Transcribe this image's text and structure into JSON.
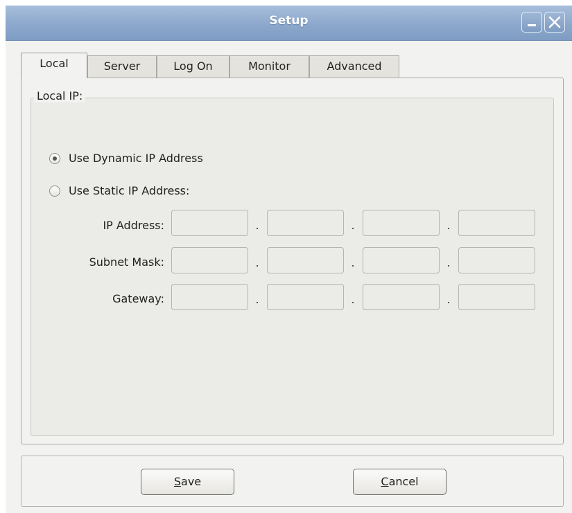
{
  "window": {
    "title": "Setup"
  },
  "tabs": [
    {
      "label": "Local",
      "active": true
    },
    {
      "label": "Server",
      "active": false
    },
    {
      "label": "Log On",
      "active": false
    },
    {
      "label": "Monitor",
      "active": false
    },
    {
      "label": "Advanced",
      "active": false
    }
  ],
  "local": {
    "group_label": "Local IP:",
    "dynamic_label": "Use Dynamic IP Address",
    "static_label": "Use Static IP Address:",
    "selected": "dynamic",
    "fields": [
      {
        "label": "IP Address:",
        "octets": [
          "",
          "",
          "",
          ""
        ]
      },
      {
        "label": "Subnet Mask:",
        "octets": [
          "",
          "",
          "",
          ""
        ]
      },
      {
        "label": "Gateway:",
        "octets": [
          "",
          "",
          "",
          ""
        ]
      }
    ],
    "separator": "."
  },
  "buttons": {
    "save": {
      "mnemonic": "S",
      "rest": "ave"
    },
    "cancel": {
      "mnemonic": "C",
      "rest": "ancel"
    }
  },
  "colors": {
    "titlebar": "#8ca8cc",
    "window_bg": "#f2f2f0"
  }
}
